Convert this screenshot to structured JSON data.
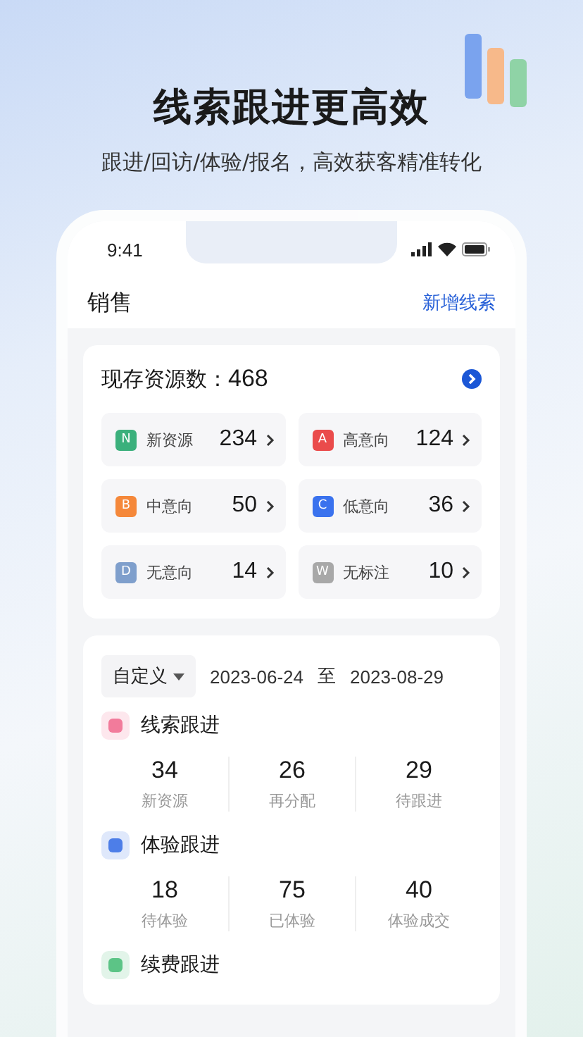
{
  "headline": "线索跟进更高效",
  "subtitle": "跟进/回访/体验/报名，高效获客精准转化",
  "phone": {
    "status_bar": {
      "time": "9:41"
    },
    "header": {
      "title": "销售",
      "action": "新增线索"
    },
    "summary": {
      "label": "现存资源数：",
      "count": "468",
      "categories": [
        {
          "badge": "N",
          "label": "新资源",
          "count": "234",
          "color": "#3bb07c"
        },
        {
          "badge": "A",
          "label": "高意向",
          "count": "124",
          "color": "#ea4b4b"
        },
        {
          "badge": "B",
          "label": "中意向",
          "count": "50",
          "color": "#f5883a"
        },
        {
          "badge": "C",
          "label": "低意向",
          "count": "36",
          "color": "#3a72ee"
        },
        {
          "badge": "D",
          "label": "无意向",
          "count": "14",
          "color": "#7f9fcc"
        },
        {
          "badge": "W",
          "label": "无标注",
          "count": "10",
          "color": "#a8a8a8"
        }
      ]
    },
    "followup": {
      "filter": "自定义",
      "date_from": "2023-06-24",
      "date_separator": "至",
      "date_to": "2023-08-29",
      "sections": [
        {
          "title": "线索跟进",
          "color": "#f27b9b",
          "stats": [
            {
              "value": "34",
              "label": "新资源"
            },
            {
              "value": "26",
              "label": "再分配"
            },
            {
              "value": "29",
              "label": "待跟进"
            }
          ]
        },
        {
          "title": "体验跟进",
          "color": "#4d7ee8",
          "stats": [
            {
              "value": "18",
              "label": "待体验"
            },
            {
              "value": "75",
              "label": "已体验"
            },
            {
              "value": "40",
              "label": "体验成交"
            }
          ]
        },
        {
          "title": "续费跟进",
          "color": "#5cc486"
        }
      ]
    }
  }
}
